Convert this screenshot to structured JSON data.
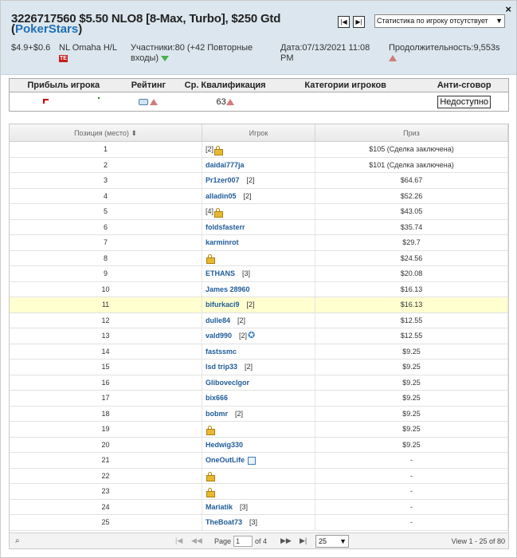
{
  "header": {
    "title_line1": "3226717560 $5.50 NLO8 [8-Max, Turbo], $250 Gtd",
    "title_line2_prefix": "(",
    "room": "PokerStars",
    "title_line2_suffix": ")",
    "close": "×",
    "nav_first": "|◀",
    "nav_last": "▶|",
    "stat_select_value": "Статистика по игроку отсутствует",
    "buyin": "$4.9+$0.6",
    "game": "NL Omaha H/L",
    "te_badge": "TE",
    "participants": "Участники:80 (+42 Повторные входы)",
    "date": "Дата:07/13/2021 11:08 PM",
    "duration": "Продолжительность:9,553s"
  },
  "summary": {
    "headers": [
      "Прибыль игрока",
      "Рейтинг",
      "Ср. Квалификация",
      "Категории игроков",
      "Анти-сговор"
    ],
    "avg_qualification": "63",
    "anti_collusion_button": "Недоступно"
  },
  "grid": {
    "col_position": "Позиция (место)",
    "col_player": "Игрок",
    "col_prize": "Приз",
    "rows": [
      {
        "pos": "1",
        "name": "",
        "count": "[2]",
        "prize": "$105 (Сделка заключена)"
      },
      {
        "pos": "2",
        "name": "daidai777ja",
        "count": "",
        "prize": "$101 (Сделка заключена)"
      },
      {
        "pos": "3",
        "name": "Pr1zer007",
        "count": "[2]",
        "prize": "$64.67"
      },
      {
        "pos": "4",
        "name": "alladin05",
        "count": "[2]",
        "prize": "$52.26"
      },
      {
        "pos": "5",
        "name": "",
        "count": "[4]",
        "prize": "$43.05"
      },
      {
        "pos": "6",
        "name": "foldsfasterr",
        "count": "",
        "prize": "$35.74"
      },
      {
        "pos": "7",
        "name": "karminrot",
        "count": "",
        "prize": "$29.7"
      },
      {
        "pos": "8",
        "name": "",
        "count": "",
        "prize": "$24.56"
      },
      {
        "pos": "9",
        "name": "ETHANS",
        "count": "[3]",
        "prize": "$20.08"
      },
      {
        "pos": "10",
        "name": "James 28960",
        "count": "",
        "prize": "$16.13"
      },
      {
        "pos": "11",
        "name": "bifurkaci9",
        "count": "[2]",
        "prize": "$16.13"
      },
      {
        "pos": "12",
        "name": "dulle84",
        "count": "[2]",
        "prize": "$12.55"
      },
      {
        "pos": "13",
        "name": "vald990",
        "count": "[2]",
        "prize": "$12.55"
      },
      {
        "pos": "14",
        "name": "fastssmc",
        "count": "",
        "prize": "$9.25"
      },
      {
        "pos": "15",
        "name": "lsd trip33",
        "count": "[2]",
        "prize": "$9.25"
      },
      {
        "pos": "16",
        "name": "GlibovecIgor",
        "count": "",
        "prize": "$9.25"
      },
      {
        "pos": "17",
        "name": "bix666",
        "count": "",
        "prize": "$9.25"
      },
      {
        "pos": "18",
        "name": "bobmr",
        "count": "[2]",
        "prize": "$9.25"
      },
      {
        "pos": "19",
        "name": "",
        "count": "",
        "prize": "$9.25"
      },
      {
        "pos": "20",
        "name": "Hedwig330",
        "count": "",
        "prize": "$9.25"
      },
      {
        "pos": "21",
        "name": "OneOutLife",
        "count": "",
        "prize": "-"
      },
      {
        "pos": "22",
        "name": "",
        "count": "",
        "prize": "-"
      },
      {
        "pos": "23",
        "name": "",
        "count": "",
        "prize": "-"
      },
      {
        "pos": "24",
        "name": "Mariatik",
        "count": "[3]",
        "prize": "-"
      },
      {
        "pos": "25",
        "name": "TheBoat73",
        "count": "[3]",
        "prize": "-"
      }
    ]
  },
  "pager": {
    "page_label": "Page",
    "page_value": "1",
    "of_label": "of 4",
    "page_size": "25",
    "view_label": "View 1 - 25 of 80"
  },
  "colors": {
    "header_bg": "#dbe6ee",
    "link": "#1f5c99",
    "highlight_row": "#ffffd0",
    "up_arrow": "#d47a7a",
    "down_arrow": "#4caf50"
  }
}
